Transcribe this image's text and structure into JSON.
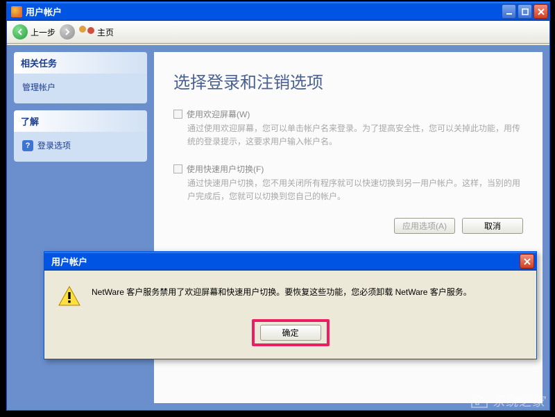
{
  "window": {
    "title": "用户帐户"
  },
  "toolbar": {
    "back": "上一步",
    "home": "主页"
  },
  "sidebar": {
    "panels": [
      {
        "head": "相关任务",
        "items": [
          {
            "label": "管理帐户"
          }
        ]
      },
      {
        "head": "了解",
        "items": [
          {
            "label": "登录选项",
            "has_q_icon": true
          }
        ]
      }
    ]
  },
  "content": {
    "heading": "选择登录和注销选项",
    "options": [
      {
        "title": "使用欢迎屏幕(W)",
        "desc": "通过使用欢迎屏幕，您可以单击帐户名来登录。为了提高安全性，您可以关掉此功能，用传统的登录提示，这要求用户输入帐户名。"
      },
      {
        "title": "使用快速用户切换(F)",
        "desc": "通过快速用户切换，您不用关闭所有程序就可以快速切换到另一用户帐户。这样，当别的用户完成后，您就可以切换到您自己的帐户。"
      }
    ],
    "apply_btn": "应用选项(A)",
    "cancel_btn": "取消"
  },
  "dialog": {
    "title": "用户帐户",
    "message": "NetWare 客户服务禁用了欢迎屏幕和快速用户切换。要恢复这些功能，您必须卸载 NetWare 客户服务。",
    "ok_btn": "确定"
  },
  "watermark": "系统之家",
  "colors": {
    "highlight": "#e91e63"
  }
}
